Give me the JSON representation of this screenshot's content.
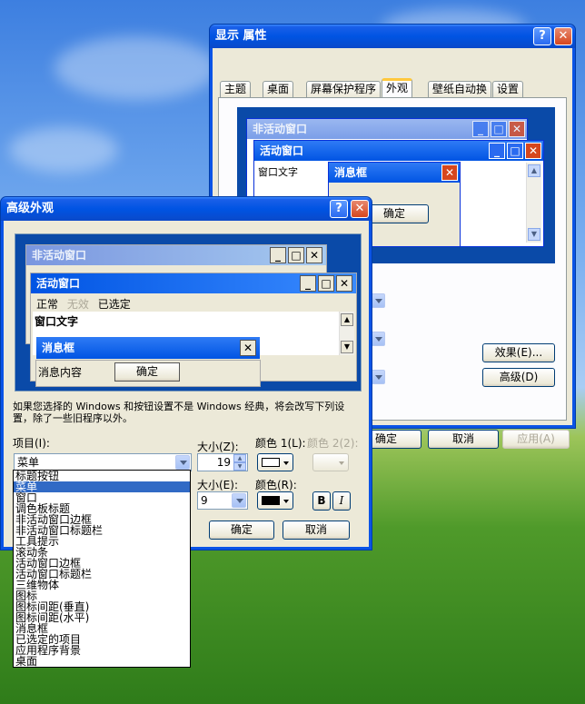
{
  "display_props": {
    "title": "显示 属性",
    "tabs": [
      "主题",
      "桌面",
      "屏幕保护程序",
      "外观",
      "壁纸自动换",
      "设置"
    ],
    "preview": {
      "inactive_title": "非活动窗口",
      "active_title": "活动窗口",
      "window_text": "窗口文字",
      "msgbox_title": "消息框",
      "ok": "确定"
    },
    "effects_button": "效果(E)...",
    "advanced_button": "高级(D)",
    "ok_button": "确定",
    "cancel_button": "取消",
    "apply_button": "应用(A)"
  },
  "advanced": {
    "title": "高级外观",
    "preview": {
      "inactive_title": "非活动窗口",
      "active_title": "活动窗口",
      "menu_normal": "正常",
      "menu_disabled": "无效",
      "menu_selected": "已选定",
      "window_text": "窗口文字",
      "msgbox_title": "消息框",
      "msg_content": "消息内容",
      "msg_ok": "确定"
    },
    "notice": "如果您选择的 Windows 和按钮设置不是 Windows 经典，将会改写下列设置，除了一些旧程序以外。",
    "item_label": "项目(I):",
    "item_value": "菜单",
    "size_label": "大小(Z):",
    "size_value": "19",
    "color1_label": "颜色 1(L):",
    "color2_label": "颜色 2(2):",
    "font_size_label": "大小(E):",
    "font_size_value": "9",
    "font_color_label": "颜色(R):",
    "bold_label": "B",
    "italic_label": "I",
    "ok_button": "确定",
    "cancel_button": "取消",
    "items_list": [
      "标题按钮",
      "菜单",
      "窗口",
      "调色板标题",
      "非活动窗口边框",
      "非活动窗口标题栏",
      "工具提示",
      "滚动条",
      "活动窗口边框",
      "活动窗口标题栏",
      "三维物体",
      "图标",
      "图标间距(垂直)",
      "图标间距(水平)",
      "消息框",
      "已选定的项目",
      "应用程序背景",
      "桌面"
    ],
    "selected_index": 1
  },
  "colors": {
    "xp_blue": "#0054e3",
    "selection": "#316ac5",
    "dialog_bg": "#ece9d8"
  }
}
